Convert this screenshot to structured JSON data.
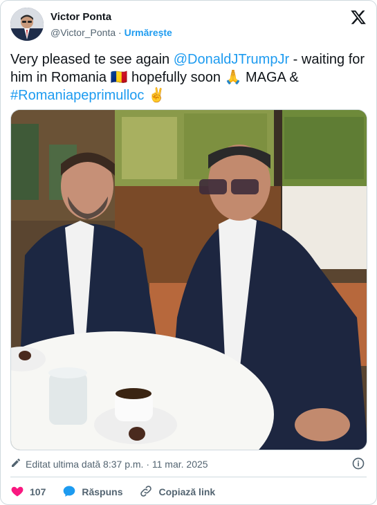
{
  "author": {
    "name": "Victor Ponta",
    "handle": "@Victor_Ponta",
    "separator": "·",
    "follow_label": "Urmărește"
  },
  "tweet": {
    "text_part1": "Very pleased te see again ",
    "mention": "@DonaldJTrumpJr",
    "text_part2": " - waiting for him in Romania ",
    "text_part3": " hopefully soon ",
    "text_part4": " MAGA  & ",
    "hashtag": "#Romaniapeprimulloc",
    "emoji_flag": "🇷🇴",
    "emoji_pray": "🙏",
    "emoji_victory": "✌️"
  },
  "meta": {
    "edited_label": "Editat ultima dată 8:37 p.m. · 11 mar. 2025"
  },
  "actions": {
    "like_count": "107",
    "reply_label": "Răspuns",
    "copy_label": "Copiază link"
  },
  "colors": {
    "link": "#1d9bf0",
    "like": "#f91880",
    "muted": "#536471"
  }
}
